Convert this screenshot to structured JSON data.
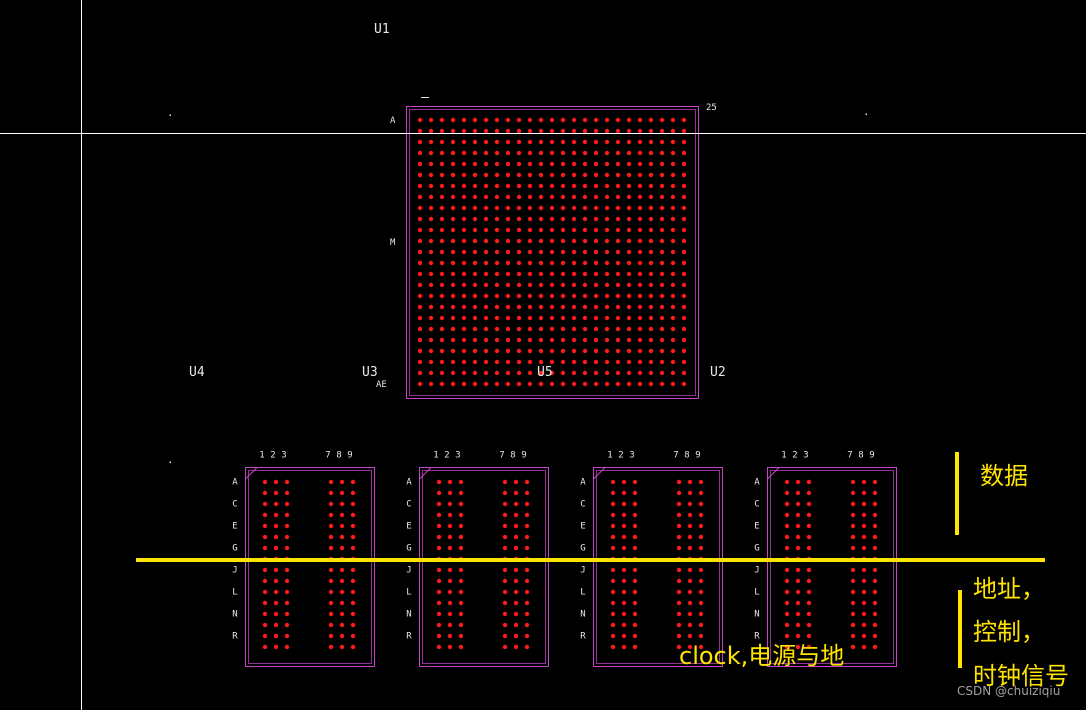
{
  "colors": {
    "background": "#000000",
    "pad": "#ff1a1a",
    "outline": "#c644c8",
    "silk_text": "#e6e6e6",
    "annotation": "#ffe400",
    "crosshair": "#ffffff",
    "watermark": "#a0a0a0"
  },
  "refdes": {
    "u1": "U1",
    "u2": "U2",
    "u3": "U3",
    "u4": "U4",
    "u5": "U5"
  },
  "bga": {
    "pad_rows": 25,
    "pad_columns": 25,
    "row_label_first": "A",
    "row_label_middle": "M",
    "row_label_last": "AE",
    "column_label_last": "25"
  },
  "memory": {
    "chip_count": 4,
    "pad_rows": 16,
    "column_labels": [
      "1",
      "2",
      "3",
      "7",
      "8",
      "9"
    ],
    "row_labels": [
      "A",
      "C",
      "E",
      "G",
      "J",
      "L",
      "N",
      "R"
    ]
  },
  "annotations": {
    "data": "数据",
    "address": "地址，",
    "control": "控制，",
    "clock_signal": "时钟信号",
    "clock_power_ground": "clock,电源与地"
  },
  "watermark": "CSDN @chuiziqiu"
}
